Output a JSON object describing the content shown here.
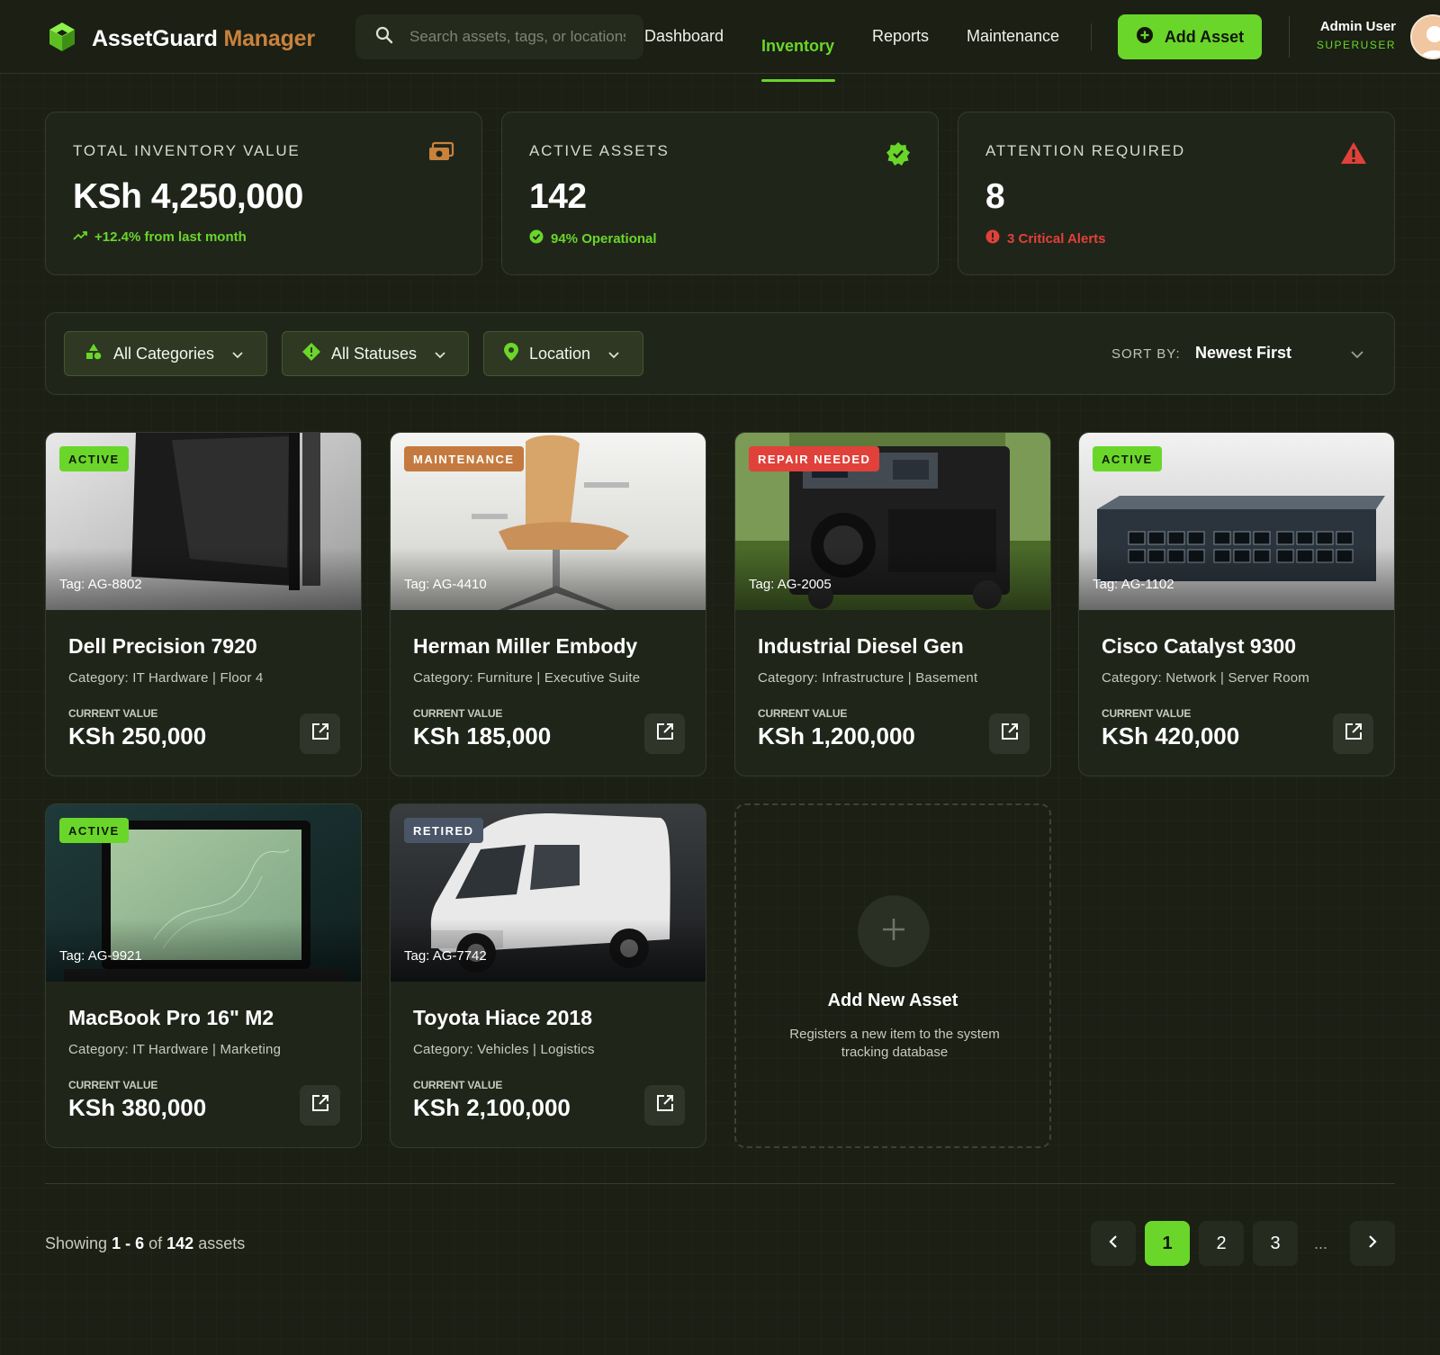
{
  "header": {
    "brand_main": "AssetGuard",
    "brand_accent": "Manager",
    "search_placeholder": "Search assets, tags, or locations...",
    "nav": [
      "Dashboard",
      "Inventory",
      "Reports",
      "Maintenance"
    ],
    "active_nav": "Inventory",
    "add_button": "Add Asset",
    "user_name": "Admin User",
    "user_role": "SUPERUSER"
  },
  "stats": [
    {
      "label": "TOTAL INVENTORY VALUE",
      "value": "KSh 4,250,000",
      "foot": "+12.4% from last month",
      "icon": "money-icon",
      "foot_color": "#6ad62a"
    },
    {
      "label": "ACTIVE ASSETS",
      "value": "142",
      "foot": "94% Operational",
      "icon": "verified-badge-icon",
      "foot_color": "#6ad62a"
    },
    {
      "label": "ATTENTION REQUIRED",
      "value": "8",
      "foot": "3 Critical Alerts",
      "icon": "warning-icon",
      "foot_color": "#e0413a"
    }
  ],
  "filters": {
    "categories": "All Categories",
    "statuses": "All Statuses",
    "location": "Location",
    "sort_label": "SORT BY:",
    "sort_value": "Newest First"
  },
  "assets": [
    {
      "status": "ACTIVE",
      "tag": "Tag: AG-8802",
      "name": "Dell Precision 7920",
      "category": "Category: IT Hardware | Floor 4",
      "value_label": "CURRENT VALUE",
      "value": "KSh 250,000"
    },
    {
      "status": "MAINTENANCE",
      "tag": "Tag: AG-4410",
      "name": "Herman Miller Embody",
      "category": "Category: Furniture | Executive Suite",
      "value_label": "CURRENT VALUE",
      "value": "KSh 185,000"
    },
    {
      "status": "REPAIR NEEDED",
      "tag": "Tag: AG-2005",
      "name": "Industrial Diesel Gen",
      "category": "Category: Infrastructure | Basement",
      "value_label": "CURRENT VALUE",
      "value": "KSh 1,200,000"
    },
    {
      "status": "ACTIVE",
      "tag": "Tag: AG-1102",
      "name": "Cisco Catalyst 9300",
      "category": "Category: Network | Server Room",
      "value_label": "CURRENT VALUE",
      "value": "KSh 420,000"
    },
    {
      "status": "ACTIVE",
      "tag": "Tag: AG-9921",
      "name": "MacBook Pro 16\" M2",
      "category": "Category: IT Hardware | Marketing",
      "value_label": "CURRENT VALUE",
      "value": "KSh 380,000"
    },
    {
      "status": "RETIRED",
      "tag": "Tag: AG-7742",
      "name": "Toyota Hiace 2018",
      "category": "Category: Vehicles | Logistics",
      "value_label": "CURRENT VALUE",
      "value": "KSh 2,100,000"
    }
  ],
  "add_card": {
    "title": "Add New Asset",
    "description": "Registers a new item to the system tracking database"
  },
  "pagination": {
    "showing_prefix": "Showing",
    "range": "1 - 6",
    "of": "of",
    "total": "142",
    "suffix": "assets",
    "pages": [
      "1",
      "2",
      "3"
    ],
    "ellipsis": "...",
    "current": "1"
  },
  "colors": {
    "accent": "#6ad62a",
    "brand_accent": "#c9823c",
    "status_active": "#6ad62a",
    "status_maintenance": "#c47a3e",
    "status_repair": "#e0413a",
    "status_retired": "#4a5568"
  }
}
